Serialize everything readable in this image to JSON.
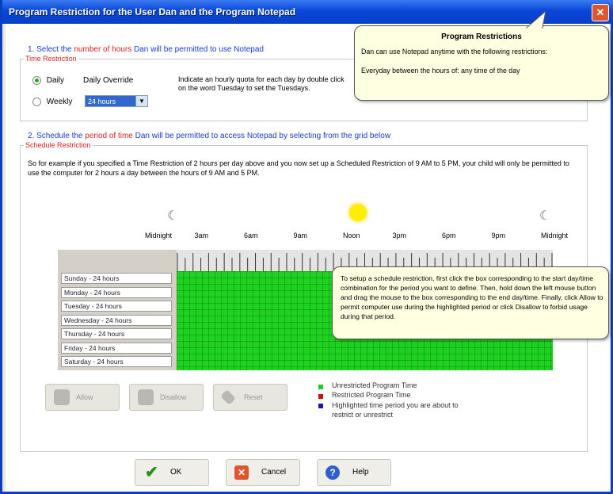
{
  "window": {
    "title": "Program Restriction for the User Dan and the Program Notepad",
    "close_glyph": "✕"
  },
  "step1": {
    "prefix": "1. Select the ",
    "highlight": "number of hours",
    "suffix": " Dan will be permitted to use Notepad"
  },
  "time_restriction": {
    "legend": "Time Restriction",
    "daily_label": "Daily",
    "weekly_label": "Weekly",
    "override_label": "Daily Override",
    "hours_value": "24 hours",
    "instructions": "Indicate an hourly quota for each day by double click on the word Tuesday to set the Tuesdays."
  },
  "step2": {
    "prefix": "2. Schedule the ",
    "highlight": "period of time",
    "suffix": " Dan will be permitted to access Notepad by selecting from the grid below"
  },
  "schedule_restriction": {
    "legend": "Schedule Restriction",
    "explanation": "So for example if you specified a Time Restriction of 2 hours per day above and you now set up a Scheduled Restriction of 9 AM to 5 PM, your child will only be permitted to use the computer for 2 hours a day between the hours of 9 AM and 5 PM."
  },
  "time_labels": [
    "Midnight",
    "3am",
    "6am",
    "9am",
    "Noon",
    "3pm",
    "6pm",
    "9pm",
    "Midnight"
  ],
  "days": [
    "Sunday - 24 hours",
    "Monday - 24 hours",
    "Tuesday - 24 hours",
    "Wednesday - 24 hours",
    "Thursday - 24 hours",
    "Friday - 24 hours",
    "Saturday - 24 hours"
  ],
  "action_buttons": {
    "allow": "Allow",
    "disallow": "Disallow",
    "reset": "Reset"
  },
  "legend": {
    "unrestricted": "Unrestricted Program Time",
    "restricted": "Restricted Program Time",
    "highlighted": "Highlighted time period you are about to restrict or unrestrict",
    "unrestricted_color": "#22cc22",
    "restricted_color": "#cc1111",
    "highlighted_color": "#1a1aa0"
  },
  "footer": {
    "ok": "OK",
    "cancel": "Cancel",
    "help": "Help"
  },
  "tooltip_top": {
    "title": "Program Restrictions",
    "line1": "Dan can use Notepad anytime with the following restrictions:",
    "line2": "Everyday between the hours of:  any time of the day"
  },
  "tooltip_grid": {
    "text": "To setup a schedule restriction, first click the box corresponding to the start day/time combination for the period you want to define. Then, hold down the left mouse button and drag the mouse to the box corresponding to the end day/time. Finally, click Allow to permit computer use during the highlighted period or click Disallow to forbid usage during that period."
  }
}
